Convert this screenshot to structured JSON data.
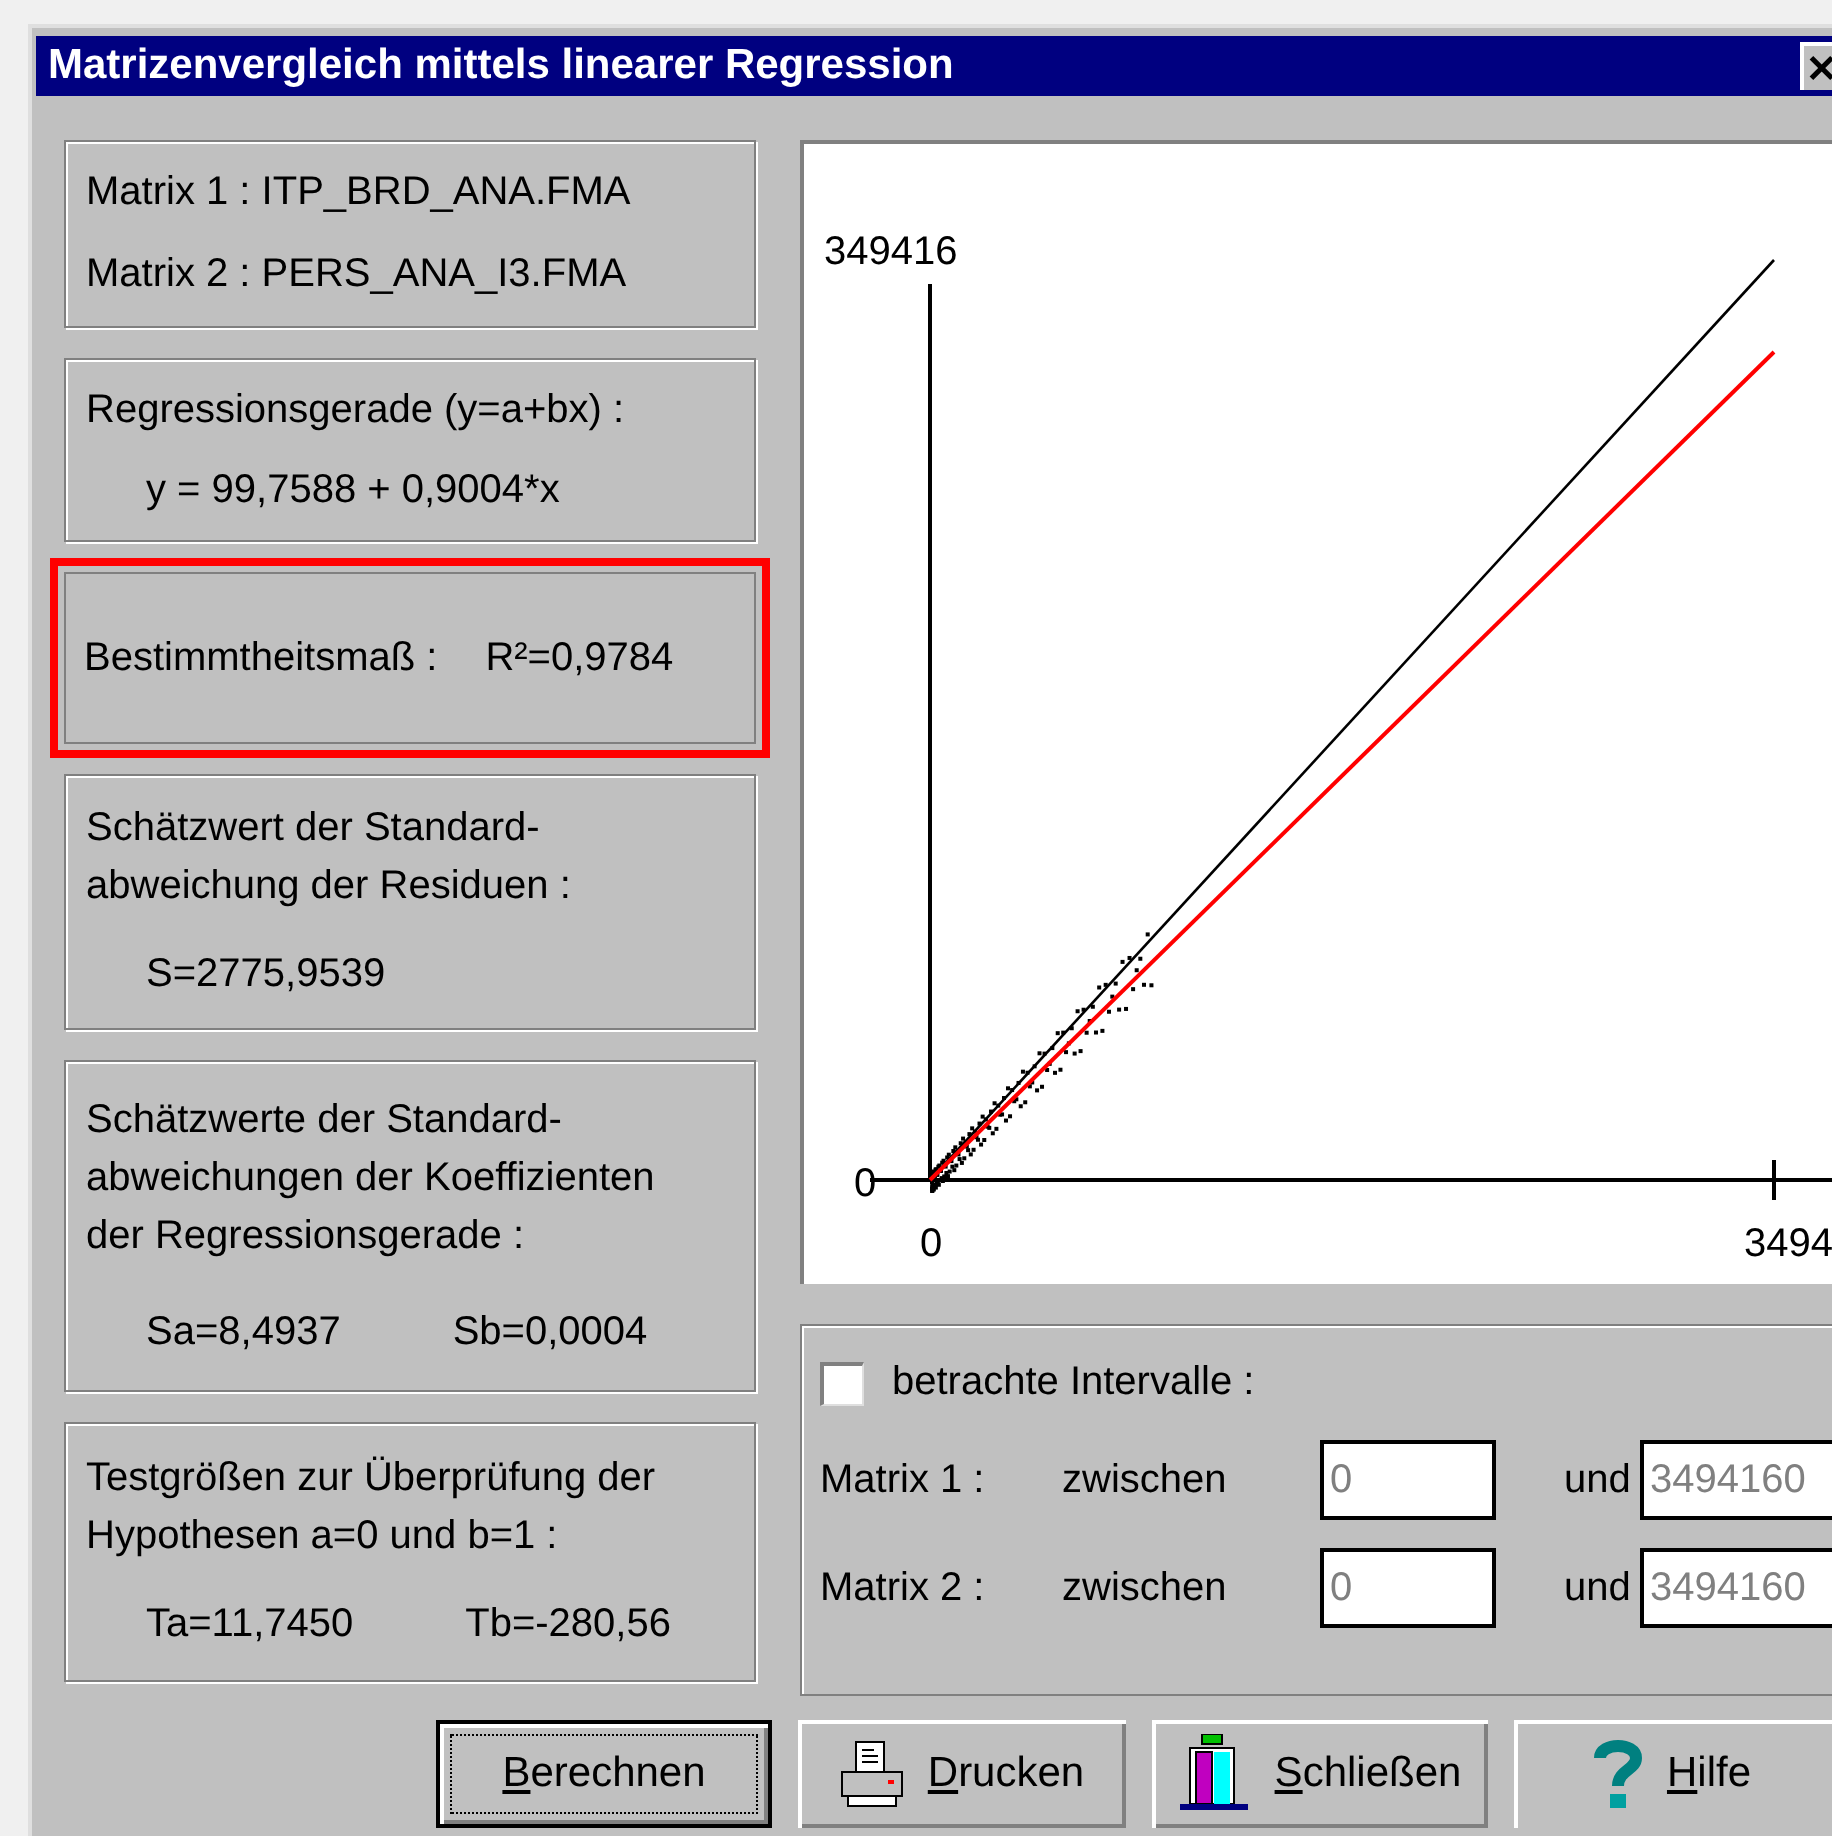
{
  "window": {
    "title": "Matrizenvergleich mittels linearer Regression"
  },
  "info_boxes": [
    {
      "lines": [
        {
          "kind": "heading",
          "text": "Matrix 1 : ITP_BRD_ANA.FMA"
        },
        {
          "kind": "heading",
          "text": "Matrix 2 : PERS_ANA_I3.FMA"
        }
      ],
      "highlighted": false
    },
    {
      "lines": [
        {
          "kind": "heading",
          "text": "Regressionsgerade (y=a+bx) :"
        },
        {
          "kind": "result",
          "text": "y = 99,7588 + 0,9004*x"
        }
      ],
      "highlighted": false
    },
    {
      "lines": [
        {
          "kind": "heading",
          "text": "Bestimmtheitsmaß :",
          "value": "R²=0,9784"
        }
      ],
      "highlighted": true
    },
    {
      "lines": [
        {
          "kind": "heading",
          "text": "Schätzwert der Standard-\nabweichung der Residuen :"
        },
        {
          "kind": "result",
          "text": "S=2775,9539"
        }
      ],
      "highlighted": false
    },
    {
      "lines": [
        {
          "kind": "heading",
          "text": "Schätzwerte der Standard-\nabweichungen der Koeffizienten\nder Regressionsgerade :"
        },
        {
          "kind": "result",
          "text": "Sa=8,4937",
          "value": "Sb=0,0004"
        }
      ],
      "highlighted": false
    },
    {
      "lines": [
        {
          "kind": "heading",
          "text": "Testgrößen zur Überprüfung der\nHypothesen a=0 und b=1 :"
        },
        {
          "kind": "result",
          "text": "Ta=11,7450",
          "value": "Tb=-280,56"
        }
      ],
      "highlighted": false
    }
  ],
  "chart": {
    "y_max_label": "349416",
    "y_min_label": "0",
    "x_min_label": "0",
    "x_max_label": "3494"
  },
  "intervals": {
    "label": "betrachte Intervalle :",
    "checked": false,
    "rows": [
      {
        "label": "Matrix 1 :",
        "between": "zwischen",
        "from": "0",
        "and": "und",
        "to": "3494160",
        "disabled": true
      },
      {
        "label": "Matrix 2 :",
        "between": "zwischen",
        "from": "0",
        "and": "und",
        "to": "3494160",
        "disabled": true
      }
    ]
  },
  "buttons": [
    {
      "kind": "calc",
      "label": "Berechnen",
      "default": true
    },
    {
      "kind": "print",
      "label": "Drucken",
      "default": false
    },
    {
      "kind": "close",
      "label": "Schließen",
      "default": false
    },
    {
      "kind": "help",
      "label": "Hilfe",
      "default": false
    }
  ]
}
